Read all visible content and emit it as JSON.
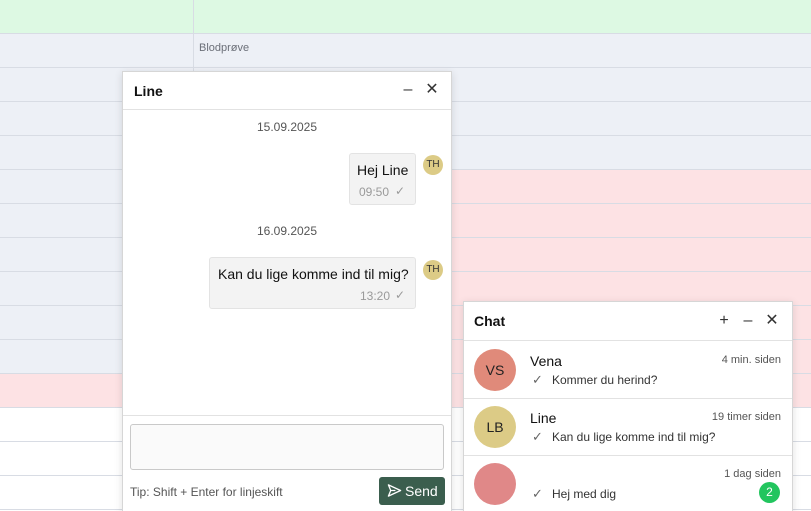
{
  "calendar": {
    "cell_label": "Blodprøve",
    "row_colors": [
      "#ddf9e3",
      "#edf0f6",
      "#edf0f6",
      "#edf0f6",
      "#edf0f6",
      "#edf0f6",
      "#edf0f6",
      "#edf0f6",
      "#edf0f6",
      "#edf0f6",
      "#edf0f6",
      "#fde2e4",
      "#ffffff",
      "#ffffff",
      "#ffffff"
    ],
    "row_colors_right": [
      "#ddf9e3",
      "#edf0f6",
      "#edf0f6",
      "#edf0f6",
      "#edf0f6",
      "#fde2e4",
      "#fde2e4",
      "#fde2e4",
      "#fde2e4",
      "#fde2e4",
      "#fde2e4",
      "#fde2e4",
      "#ffffff",
      "#ffffff",
      "#ffffff"
    ]
  },
  "chat_window": {
    "title": "Line",
    "minimize_icon": "minus-icon",
    "close_icon": "close-icon",
    "messages": [
      {
        "date": "15.09.2025",
        "text": "Hej Line",
        "time": "09:50",
        "sender_initials": "TH"
      },
      {
        "date": "16.09.2025",
        "text": "Kan du lige komme ind til mig?",
        "time": "13:20",
        "sender_initials": "TH"
      }
    ],
    "input_placeholder": "",
    "tip": "Tip: Shift + Enter for linjeskift",
    "send_label": "Send",
    "send_button_color": "#3b5e4e"
  },
  "chat_list": {
    "title": "Chat",
    "items": [
      {
        "initials": "VS",
        "name": "Vena",
        "time": "4 min. siden",
        "preview": "Kommer du herind?",
        "avatar_color": "#e08a7a",
        "unread": ""
      },
      {
        "initials": "LB",
        "name": "Line",
        "time": "19 timer siden",
        "preview": "Kan du lige komme ind til mig?",
        "avatar_color": "#dccb86",
        "unread": ""
      },
      {
        "initials": "",
        "name": "",
        "time": "1 dag siden",
        "preview": "Hej med dig",
        "avatar_color": "#e08888",
        "unread": "2"
      }
    ]
  }
}
